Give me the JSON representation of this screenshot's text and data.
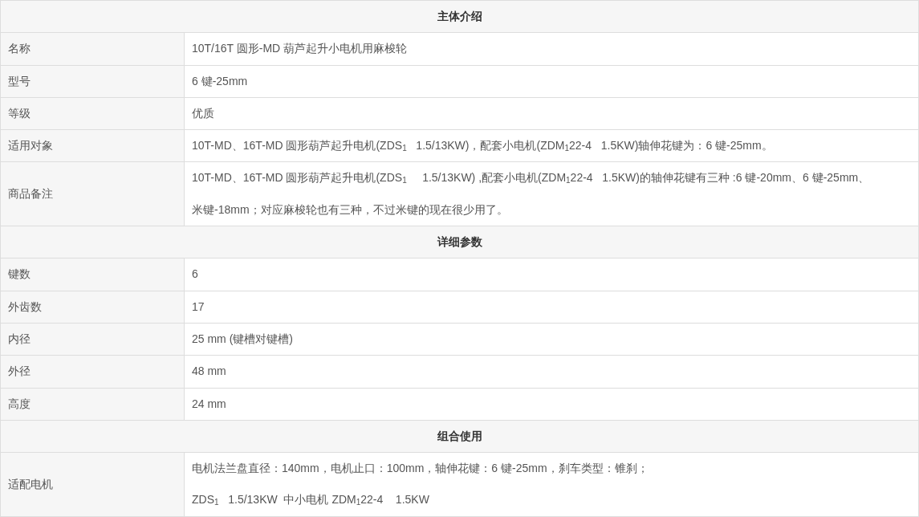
{
  "sections": [
    {
      "title": "主体介绍",
      "rows": [
        {
          "label": "名称",
          "value": "10T/16T 圆形-MD 葫芦起升小电机用麻梭轮"
        },
        {
          "label": "型号",
          "value": "6 键-25mm"
        },
        {
          "label": "等级",
          "value": "优质"
        },
        {
          "label": "适用对象",
          "value": "10T-MD、16T-MD 圆形葫芦起升电机(ZDS$_{1}$   1.5/13KW)，配套小电机(ZDM$_{1}$22-4   1.5KW)轴伸花键为：6 键-25mm。"
        },
        {
          "label": "商品备注",
          "value": "10T-MD、16T-MD 圆形葫芦起升电机(ZDS$_{1}$     1.5/13KW) ,配套小电机(ZDM$_{1}$22-4   1.5KW)的轴伸花键有三种 :6 键-20mm、6 键-25mm、米键-18mm；对应麻梭轮也有三种，不过米键的现在很少用了。"
        }
      ]
    },
    {
      "title": "详细参数",
      "rows": [
        {
          "label": "键数",
          "value": "6"
        },
        {
          "label": "外齿数",
          "value": "17"
        },
        {
          "label": "内径",
          "value": "25 mm (键槽对键槽)"
        },
        {
          "label": "外径",
          "value": "48 mm"
        },
        {
          "label": "高度",
          "value": "24 mm"
        }
      ]
    },
    {
      "title": "组合使用",
      "rows": [
        {
          "label": "适配电机",
          "lines": [
            "电机法兰盘直径：140mm，电机止口：100mm，轴伸花键：6 键-25mm，刹车类型：锥刹；",
            "ZDS$_{1}$   1.5/13KW  中小电机 ZDM$_{1}$22-4    1.5KW"
          ]
        }
      ]
    }
  ]
}
